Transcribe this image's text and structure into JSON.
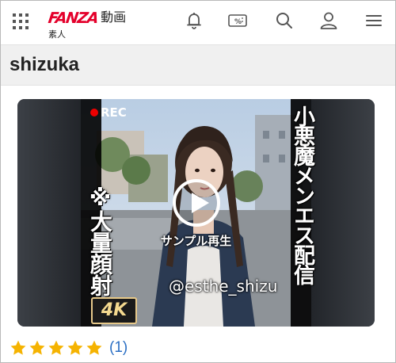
{
  "header": {
    "logo": "FANZA",
    "logo_section": "動画",
    "sub_section": "素人",
    "icons": [
      "grid-menu-icon",
      "bell-icon",
      "coupon-icon",
      "search-icon",
      "user-icon",
      "hamburger-menu-icon"
    ],
    "coupon_icon_text": "%"
  },
  "page": {
    "title": "shizuka"
  },
  "video": {
    "play_label": "サンプル再生",
    "rec_label": "REC",
    "overlay_left_text": "※大量顔射",
    "overlay_right_text": "小悪魔メンエス配信",
    "handle_text": "@esthe_shizu",
    "badge_text": "4K"
  },
  "rating": {
    "stars": 5,
    "max_stars": 5,
    "review_count_label": "(1)"
  },
  "colors": {
    "brand_red": "#e4002b",
    "star_gold": "#f5b301",
    "link_blue": "#2b6fc4",
    "title_bar_bg": "#f0f0f0"
  }
}
